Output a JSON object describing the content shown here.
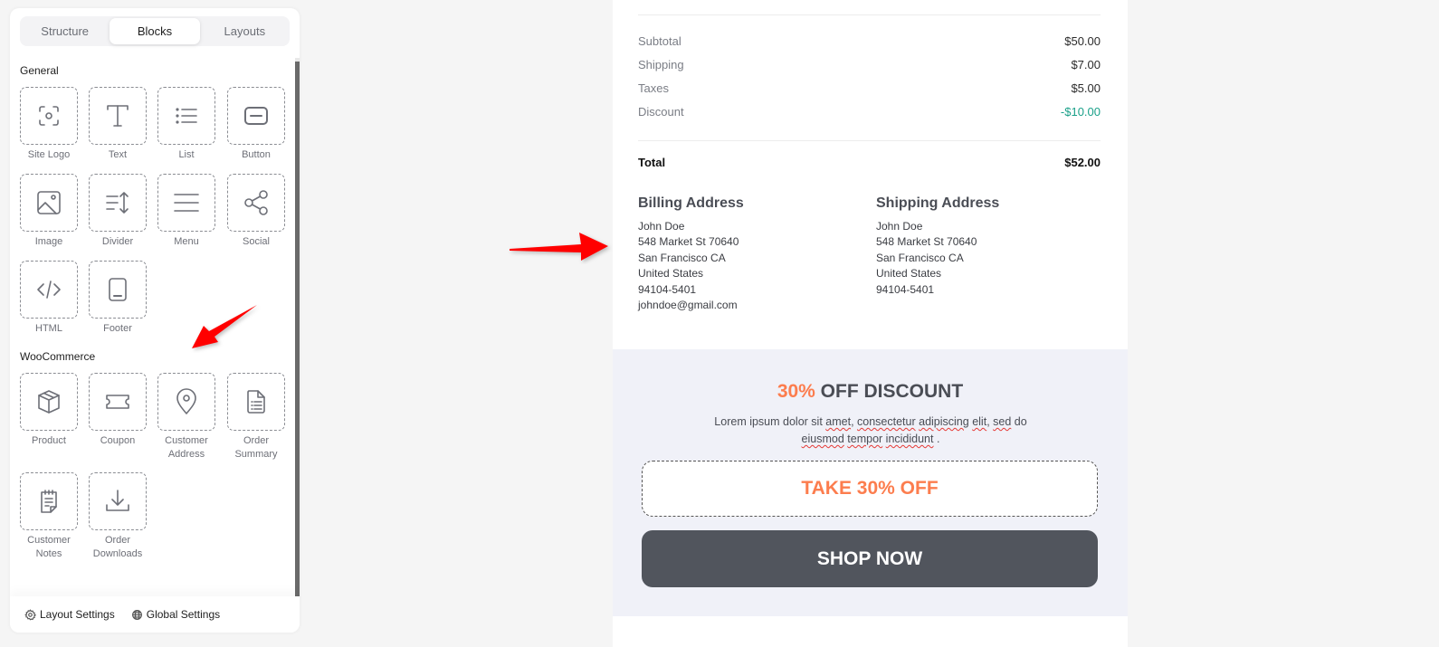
{
  "sidebar": {
    "tabs": [
      {
        "label": "Structure",
        "active": false
      },
      {
        "label": "Blocks",
        "active": true
      },
      {
        "label": "Layouts",
        "active": false
      }
    ],
    "sections": {
      "general": {
        "title": "General",
        "blocks": [
          {
            "label": "Site Logo",
            "icon": "site-logo-icon"
          },
          {
            "label": "Text",
            "icon": "text-icon"
          },
          {
            "label": "List",
            "icon": "list-icon"
          },
          {
            "label": "Button",
            "icon": "button-icon"
          },
          {
            "label": "Image",
            "icon": "image-icon"
          },
          {
            "label": "Divider",
            "icon": "divider-icon"
          },
          {
            "label": "Menu",
            "icon": "menu-icon"
          },
          {
            "label": "Social",
            "icon": "share-icon"
          },
          {
            "label": "HTML",
            "icon": "code-icon"
          },
          {
            "label": "Footer",
            "icon": "footer-icon"
          }
        ]
      },
      "woocommerce": {
        "title": "WooCommerce",
        "blocks": [
          {
            "label": "Product",
            "icon": "box-icon"
          },
          {
            "label": "Coupon",
            "icon": "ticket-icon"
          },
          {
            "label": "Customer Address",
            "icon": "map-pin-icon"
          },
          {
            "label": "Order Summary",
            "icon": "document-icon"
          },
          {
            "label": "Customer Notes",
            "icon": "notes-icon"
          },
          {
            "label": "Order Downloads",
            "icon": "download-icon"
          }
        ]
      }
    },
    "footer": {
      "layout_settings": "Layout Settings",
      "global_settings": "Global Settings"
    }
  },
  "email": {
    "summary": [
      {
        "label": "Subtotal",
        "value": "$50.00"
      },
      {
        "label": "Shipping",
        "value": "$7.00"
      },
      {
        "label": "Taxes",
        "value": "$5.00"
      },
      {
        "label": "Discount",
        "value": "-$10.00"
      }
    ],
    "total": {
      "label": "Total",
      "value": "$52.00"
    },
    "billing": {
      "title": "Billing Address",
      "lines": [
        "John Doe",
        "548 Market St 70640",
        "San Francisco CA",
        "United States",
        "94104-5401",
        "johndoe@gmail.com"
      ]
    },
    "shipping": {
      "title": "Shipping Address",
      "lines": [
        "John Doe",
        "548 Market St 70640",
        "San Francisco CA",
        "United States",
        "94104-5401"
      ]
    },
    "promo": {
      "title_highlight": "30%",
      "title_rest": " OFF DISCOUNT",
      "text_parts": [
        "Lorem ipsum dolor sit ",
        "amet",
        ", ",
        "consectetur",
        " ",
        "adipiscing",
        " ",
        "elit",
        ", ",
        "sed",
        " do ",
        "eiusmod",
        " ",
        "tempor",
        " ",
        "incididunt",
        " ."
      ],
      "coupon_label": "TAKE 30% OFF",
      "shop_label": "SHOP NOW"
    },
    "colors": {
      "accent": "#fc7d4e",
      "discount": "#1aa089",
      "button_dark": "#51555d",
      "promo_bg": "#f0f1f8"
    }
  }
}
